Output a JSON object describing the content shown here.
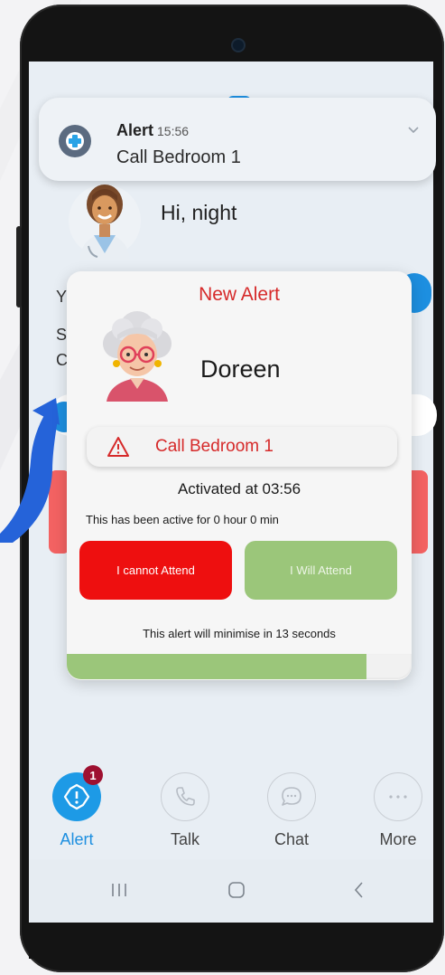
{
  "status_bar": {
    "left_text": "",
    "right_text": ""
  },
  "notification": {
    "app": "Alert",
    "time": "15:56",
    "message": "Call Bedroom 1",
    "icon": "hospital-cross-icon"
  },
  "greeting": "Hi, night",
  "background_letters": [
    "Y",
    "S",
    "C"
  ],
  "alert_modal": {
    "title": "New Alert",
    "patient_name": "Doreen",
    "call_label": "Call Bedroom 1",
    "activated_text": "Activated at 03:56",
    "active_duration_text": "This has been active for 0 hour 0 min",
    "decline_label": "I cannot Attend",
    "accept_label": "I Will Attend",
    "minimise_text": "This alert will minimise in 13 seconds",
    "progress_fraction": 0.87
  },
  "bottom_nav": {
    "items": [
      {
        "label": "Alert",
        "icon": "alert-icon",
        "active": true,
        "badge": "1"
      },
      {
        "label": "Talk",
        "icon": "phone-icon",
        "active": false
      },
      {
        "label": "Chat",
        "icon": "chat-icon",
        "active": false
      },
      {
        "label": "More",
        "icon": "more-icon",
        "active": false
      }
    ]
  },
  "colors": {
    "alert_red": "#d62a2a",
    "decline_red": "#ee0f0f",
    "accept_green": "#9bc67a",
    "primary_blue": "#1d9ae6",
    "badge": "#9e1030"
  }
}
